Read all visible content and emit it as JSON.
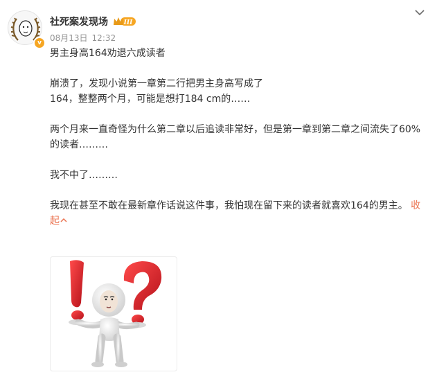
{
  "author": {
    "name": "社死案发现场",
    "level_badge": "III",
    "verified_mark": "v"
  },
  "post": {
    "date": "08月13日",
    "time": "12:32",
    "paragraphs": [
      "男主身高164劝退六成读者",
      "",
      "崩溃了，发现小说第一章第二行把男主身高写成了\n164，整整两个月，可能是想打184 cm的……",
      "",
      "两个月来一直奇怪为什么第二章以后追读非常好，但是第一章到第二章之间流失了60%\n的读者………",
      "",
      "我不中了………",
      ""
    ],
    "last_paragraph": "我现在甚至不敢在最新章作话说这件事，我怕现在留下来的读者就喜欢164的男主。 ",
    "collapse_label": "收起",
    "collapse_icon": "chevron-up-icon"
  },
  "icons": {
    "top_right": "chevron-down-icon"
  },
  "colors": {
    "accent": "#eb7350",
    "meta": "#939393",
    "text": "#333333",
    "badge_gold": "#f6a623",
    "symbol_red": "#d8282a"
  }
}
